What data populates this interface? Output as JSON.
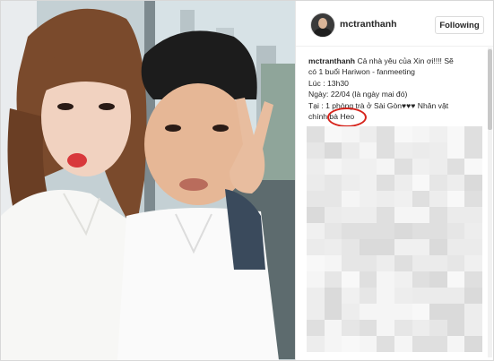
{
  "post": {
    "header": {
      "username": "mctranthanh",
      "follow_label": "Following"
    },
    "caption": {
      "username": "mctranthanh",
      "line1": "Cả nhà yêu của Xin ơi!!!! Sẽ",
      "line2": "có 1 buổi Hariwon - fanmeeting",
      "line3": "Lúc : 13h30",
      "line4": "Ngày: 22/04 (là ngày mai đó)",
      "line5": "Tại : 1 phòng trà ở Sài Gòn♥♥♥ Nhân vật",
      "line6": "chính bà Heo"
    },
    "annotation": {
      "circled_text": "bà Heo",
      "color": "#d6231b"
    },
    "colors": {
      "accent_red": "#d6231b",
      "text": "#262626",
      "border": "#dbdbdb"
    }
  }
}
